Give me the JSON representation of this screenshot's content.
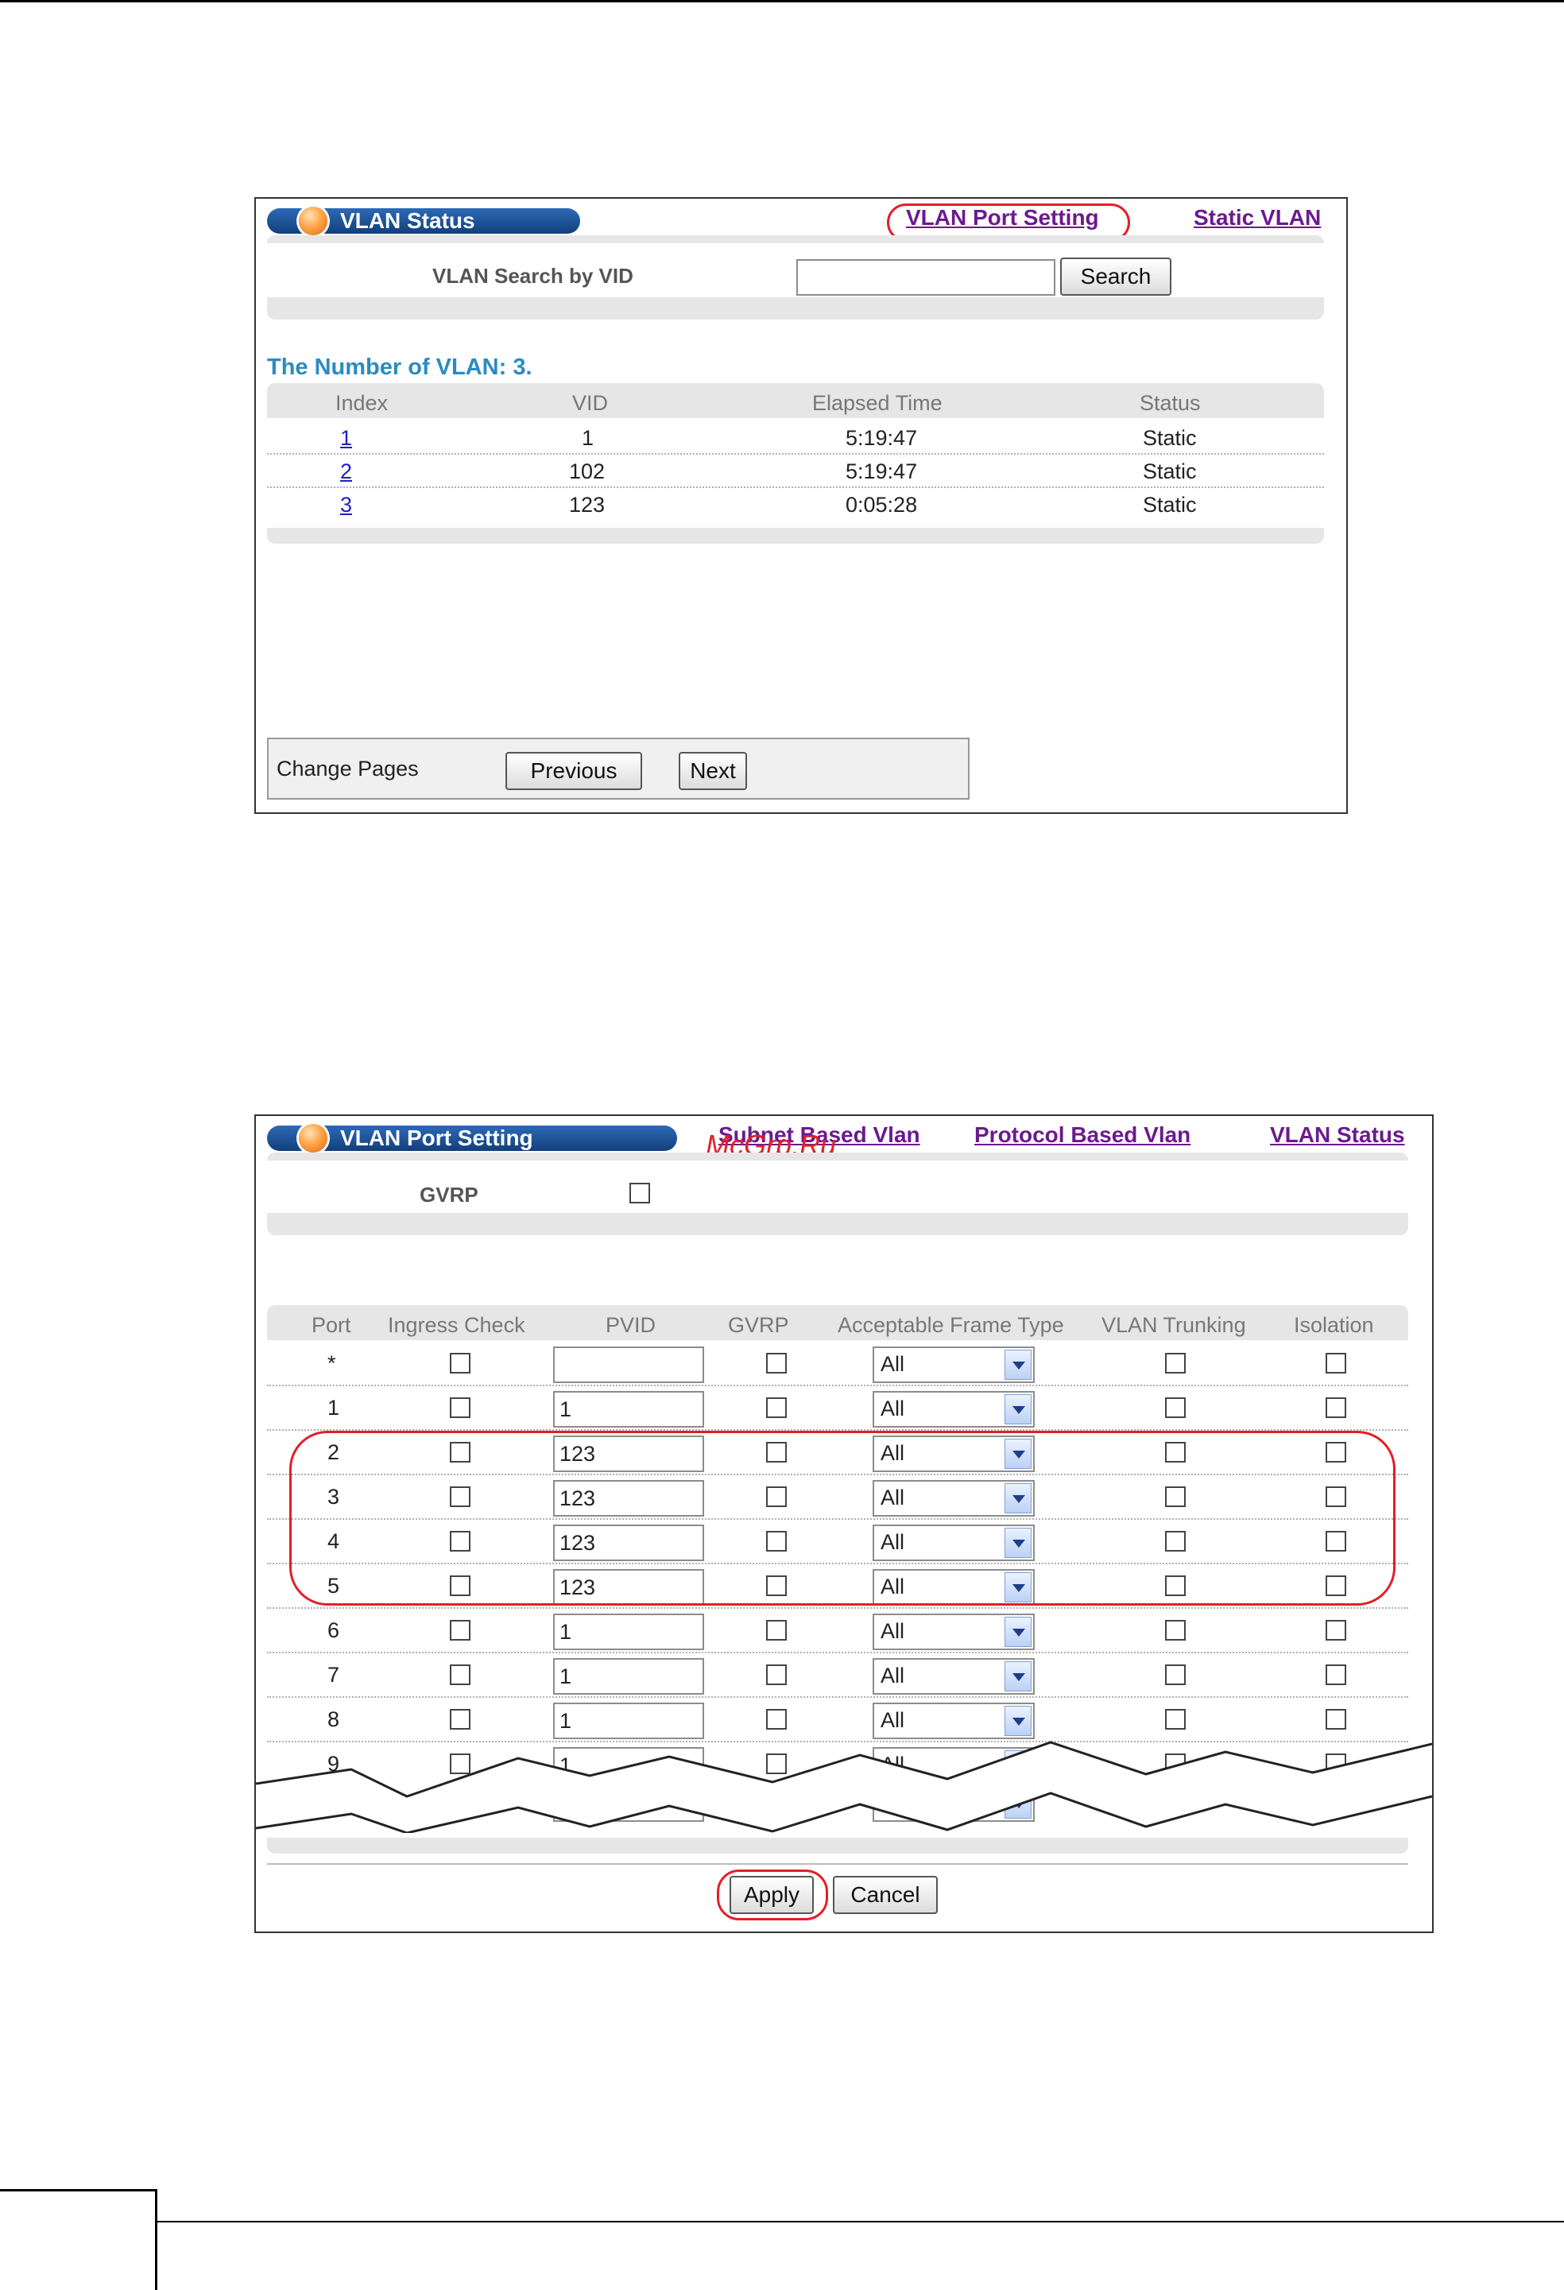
{
  "vlan_status": {
    "title": "VLAN Status",
    "links": {
      "port_setting": "VLAN Port Setting",
      "static_vlan": "Static VLAN"
    },
    "search": {
      "label": "VLAN Search by VID",
      "value": "",
      "button": "Search"
    },
    "count_text": "The Number of VLAN: 3.",
    "columns": [
      "Index",
      "VID",
      "Elapsed Time",
      "Status"
    ],
    "rows": [
      {
        "index": "1",
        "vid": "1",
        "elapsed": "5:19:47",
        "status": "Static"
      },
      {
        "index": "2",
        "vid": "102",
        "elapsed": "5:19:47",
        "status": "Static"
      },
      {
        "index": "3",
        "vid": "123",
        "elapsed": "0:05:28",
        "status": "Static"
      }
    ],
    "pager": {
      "label": "Change Pages",
      "previous": "Previous",
      "next": "Next"
    }
  },
  "vlan_port_setting": {
    "title": "VLAN Port Setting",
    "links": {
      "subnet": "Subnet Based Vlan",
      "protocol": "Protocol Based Vlan",
      "status": "VLAN Status"
    },
    "watermark": "McGrp.Ru",
    "gvrp_label": "GVRP",
    "columns": [
      "Port",
      "Ingress Check",
      "PVID",
      "GVRP",
      "Acceptable Frame Type",
      "VLAN Trunking",
      "Isolation"
    ],
    "rows": [
      {
        "port": "*",
        "pvid": "",
        "frame": "All"
      },
      {
        "port": "1",
        "pvid": "1",
        "frame": "All"
      },
      {
        "port": "2",
        "pvid": "123",
        "frame": "All"
      },
      {
        "port": "3",
        "pvid": "123",
        "frame": "All"
      },
      {
        "port": "4",
        "pvid": "123",
        "frame": "All"
      },
      {
        "port": "5",
        "pvid": "123",
        "frame": "All"
      },
      {
        "port": "6",
        "pvid": "1",
        "frame": "All"
      },
      {
        "port": "7",
        "pvid": "1",
        "frame": "All"
      },
      {
        "port": "8",
        "pvid": "1",
        "frame": "All"
      },
      {
        "port": "9",
        "pvid": "1",
        "frame": "All"
      }
    ],
    "buttons": {
      "apply": "Apply",
      "cancel": "Cancel"
    }
  }
}
